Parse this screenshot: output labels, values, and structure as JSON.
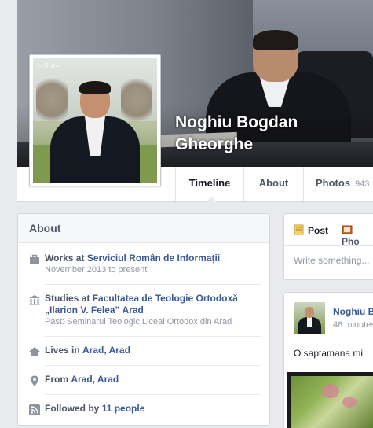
{
  "profile": {
    "name": "Noghiu Bogdan Gheorghe"
  },
  "tabs": [
    {
      "label": "Timeline",
      "count": ""
    },
    {
      "label": "About",
      "count": ""
    },
    {
      "label": "Photos",
      "count": "943"
    }
  ],
  "about": {
    "title": "About",
    "work": {
      "prefix": "Works at",
      "place": "Serviciul Român de Informații",
      "sub": "November 2013 to present"
    },
    "study": {
      "prefix": "Studies at",
      "place": "Facultatea de Teologie Ortodoxă „Ilarion V. Felea” Arad",
      "sub": "Past: Seminarul Teologic Liceal Ortodox din Arad"
    },
    "lives": {
      "prefix": "Lives in",
      "place": "Arad, Arad"
    },
    "from": {
      "prefix": "From",
      "place": "Arad, Arad"
    },
    "followed": {
      "prefix": "Followed by",
      "count": "11 people"
    }
  },
  "composer": {
    "post_label": "Post",
    "photo_label": "Pho",
    "placeholder": "Write something..."
  },
  "story": {
    "author": "Noghiu B",
    "time": "48 minutes",
    "text": "O saptamana mi"
  },
  "colors": {
    "link": "#3b5998",
    "background": "#e9eaed"
  }
}
